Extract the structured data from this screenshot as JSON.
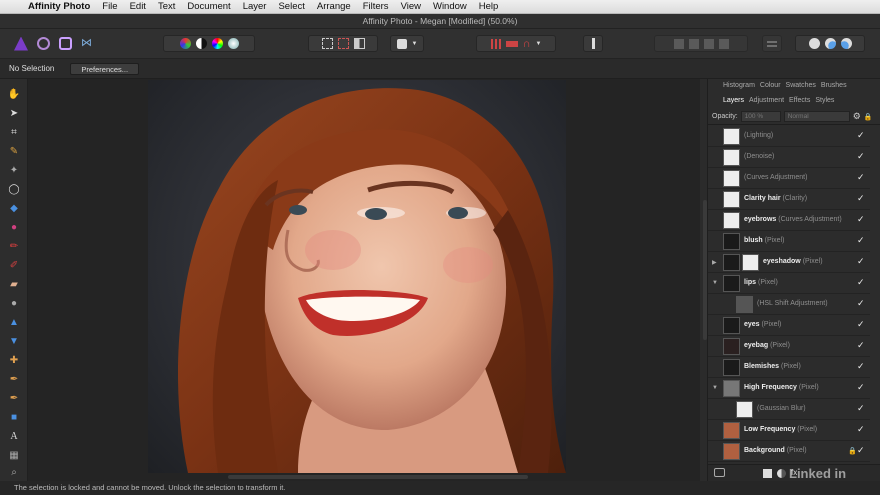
{
  "menubar": {
    "app_name": "Affinity Photo",
    "items": [
      "File",
      "Edit",
      "Text",
      "Document",
      "Layer",
      "Select",
      "Arrange",
      "Filters",
      "View",
      "Window",
      "Help"
    ]
  },
  "window": {
    "title": "Affinity Photo - Megan [Modified] (50.0%)"
  },
  "context": {
    "selection_label": "No Selection",
    "preferences_label": "Preferences..."
  },
  "panel": {
    "top_tabs": [
      "Histogram",
      "Colour",
      "Swatches",
      "Brushes"
    ],
    "layer_tabs": [
      "Layers",
      "Adjustment",
      "Effects",
      "Styles"
    ],
    "active_tab": "Layers",
    "opacity_label": "Opacity:",
    "opacity_value": "100 %",
    "blend_mode": "Normal"
  },
  "layers": [
    {
      "name": "",
      "type": "(Lighting)",
      "indent": 0,
      "arrow": "",
      "bold": false
    },
    {
      "name": "",
      "type": "(Denoise)",
      "indent": 0,
      "arrow": "",
      "bold": false
    },
    {
      "name": "",
      "type": "(Curves Adjustment)",
      "indent": 0,
      "arrow": "",
      "bold": false
    },
    {
      "name": "Clarity hair",
      "type": "(Clarity)",
      "indent": 0,
      "arrow": "",
      "bold": true
    },
    {
      "name": "eyebrows",
      "type": "(Curves Adjustment)",
      "indent": 0,
      "arrow": "",
      "bold": true
    },
    {
      "name": "blush",
      "type": "(Pixel)",
      "indent": 0,
      "arrow": "",
      "bold": true
    },
    {
      "name": "eyeshadow",
      "type": "(Pixel)",
      "indent": 0,
      "arrow": "▶",
      "bold": true,
      "mask": true
    },
    {
      "name": "lips",
      "type": "(Pixel)",
      "indent": 0,
      "arrow": "▼",
      "bold": true
    },
    {
      "name": "",
      "type": "(HSL Shift Adjustment)",
      "indent": 1,
      "arrow": "",
      "bold": false
    },
    {
      "name": "eyes",
      "type": "(Pixel)",
      "indent": 0,
      "arrow": "",
      "bold": true
    },
    {
      "name": "eyebag",
      "type": "(Pixel)",
      "indent": 0,
      "arrow": "",
      "bold": true
    },
    {
      "name": "Blemishes",
      "type": "(Pixel)",
      "indent": 0,
      "arrow": "",
      "bold": true
    },
    {
      "name": "High Frequency",
      "type": "(Pixel)",
      "indent": 0,
      "arrow": "▼",
      "bold": true
    },
    {
      "name": "",
      "type": "(Gaussian Blur)",
      "indent": 1,
      "arrow": "",
      "bold": false
    },
    {
      "name": "Low Frequency",
      "type": "(Pixel)",
      "indent": 0,
      "arrow": "",
      "bold": true
    },
    {
      "name": "Background",
      "type": "(Pixel)",
      "indent": 0,
      "arrow": "",
      "bold": true,
      "locked": true
    }
  ],
  "status": {
    "text": "The selection is locked and cannot be moved. Unlock the selection to transform it."
  },
  "watermark": "Linked in",
  "colors": {
    "accent": "#7a3cc8",
    "chrome": "#2c2c2c",
    "hair": "#8a3a18"
  }
}
